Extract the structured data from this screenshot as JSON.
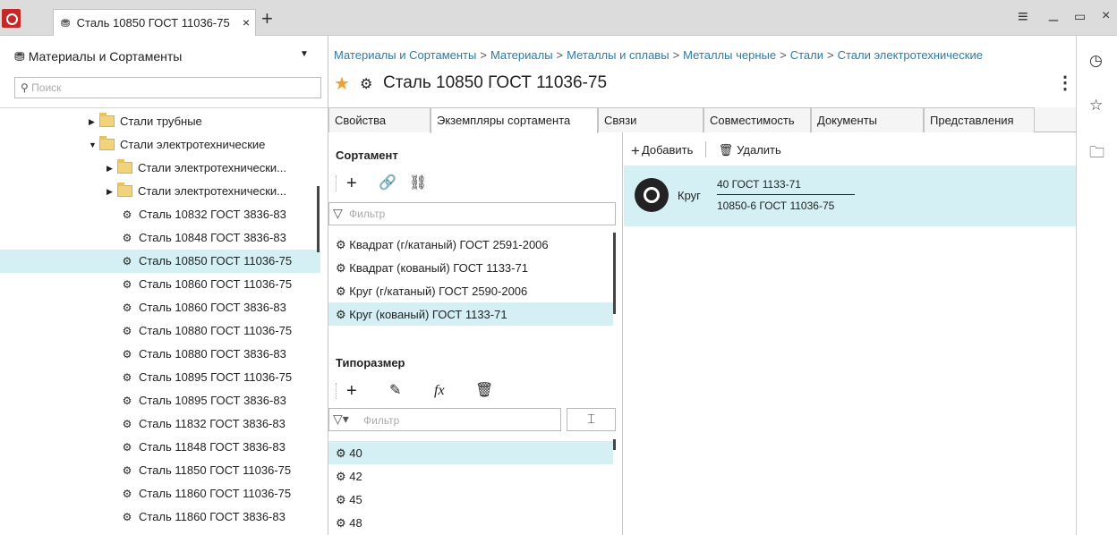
{
  "window": {
    "tab_label": "Сталь 10850 ГОСТ 11036-75",
    "tab_close": "×",
    "tab_add": "+",
    "menu_icon": "≡",
    "minimize": "_",
    "maximize": "▭",
    "close": "×"
  },
  "sidebar": {
    "title": "Материалы и Сортаменты",
    "search_placeholder": "Поиск",
    "tree": [
      {
        "label": "Стали трубные",
        "type": "folder",
        "expand": "▶"
      },
      {
        "label": "Стали электротехнические",
        "type": "folder",
        "expand": "▼"
      },
      {
        "label": "Стали электротехнически...",
        "type": "folder",
        "expand": "▶"
      },
      {
        "label": "Стали электротехнически...",
        "type": "folder",
        "expand": "▶"
      },
      {
        "label": "Сталь 10832 ГОСТ 3836-83",
        "type": "material"
      },
      {
        "label": "Сталь 10848 ГОСТ 3836-83",
        "type": "material"
      },
      {
        "label": "Сталь 10850 ГОСТ 11036-75",
        "type": "material",
        "selected": true
      },
      {
        "label": "Сталь 10860 ГОСТ 11036-75",
        "type": "material"
      },
      {
        "label": "Сталь 10860 ГОСТ 3836-83",
        "type": "material"
      },
      {
        "label": "Сталь 10880 ГОСТ 11036-75",
        "type": "material"
      },
      {
        "label": "Сталь 10880 ГОСТ 3836-83",
        "type": "material"
      },
      {
        "label": "Сталь 10895 ГОСТ 11036-75",
        "type": "material"
      },
      {
        "label": "Сталь 10895 ГОСТ 3836-83",
        "type": "material"
      },
      {
        "label": "Сталь 11832 ГОСТ 3836-83",
        "type": "material"
      },
      {
        "label": "Сталь 11848 ГОСТ 3836-83",
        "type": "material"
      },
      {
        "label": "Сталь 11850 ГОСТ 11036-75",
        "type": "material"
      },
      {
        "label": "Сталь 11860 ГОСТ 11036-75",
        "type": "material"
      },
      {
        "label": "Сталь 11860 ГОСТ 3836-83",
        "type": "material"
      }
    ]
  },
  "header": {
    "breadcrumb": [
      "Материалы и Сортаменты",
      "Материалы",
      "Металлы и сплавы",
      "Металлы черные",
      "Стали",
      "Стали электротехнические"
    ],
    "breadcrumb_sep": ">",
    "title": "Сталь 10850 ГОСТ 11036-75"
  },
  "tabs": [
    "Свойства",
    "Экземпляры сортамента",
    "Связи",
    "Совместимость",
    "Документы",
    "Представления"
  ],
  "sortament": {
    "title": "Сортамент",
    "filter_placeholder": "Фильтр",
    "items": [
      {
        "label": "Квадрат (г/катаный) ГОСТ 2591-2006"
      },
      {
        "label": "Квадрат (кованый) ГОСТ 1133-71"
      },
      {
        "label": "Круг (г/катаный) ГОСТ 2590-2006"
      },
      {
        "label": "Круг (кованый) ГОСТ 1133-71",
        "selected": true
      }
    ]
  },
  "tiporazmer": {
    "title": "Типоразмер",
    "fx_label": "fx",
    "filter_placeholder": "Фильтр",
    "items": [
      {
        "label": "40",
        "selected": true
      },
      {
        "label": "42"
      },
      {
        "label": "45"
      },
      {
        "label": "48"
      }
    ]
  },
  "instances": {
    "add_label": "Добавить",
    "delete_label": "Удалить",
    "rows": [
      {
        "kind": "Круг",
        "numerator": "40 ГОСТ 1133-71",
        "denominator": "10850-6 ГОСТ 11036-75"
      }
    ]
  },
  "colors": {
    "accent": "#c62828",
    "selection": "#d4f0f4",
    "link": "#2a7ca8",
    "star": "#f0a030"
  }
}
